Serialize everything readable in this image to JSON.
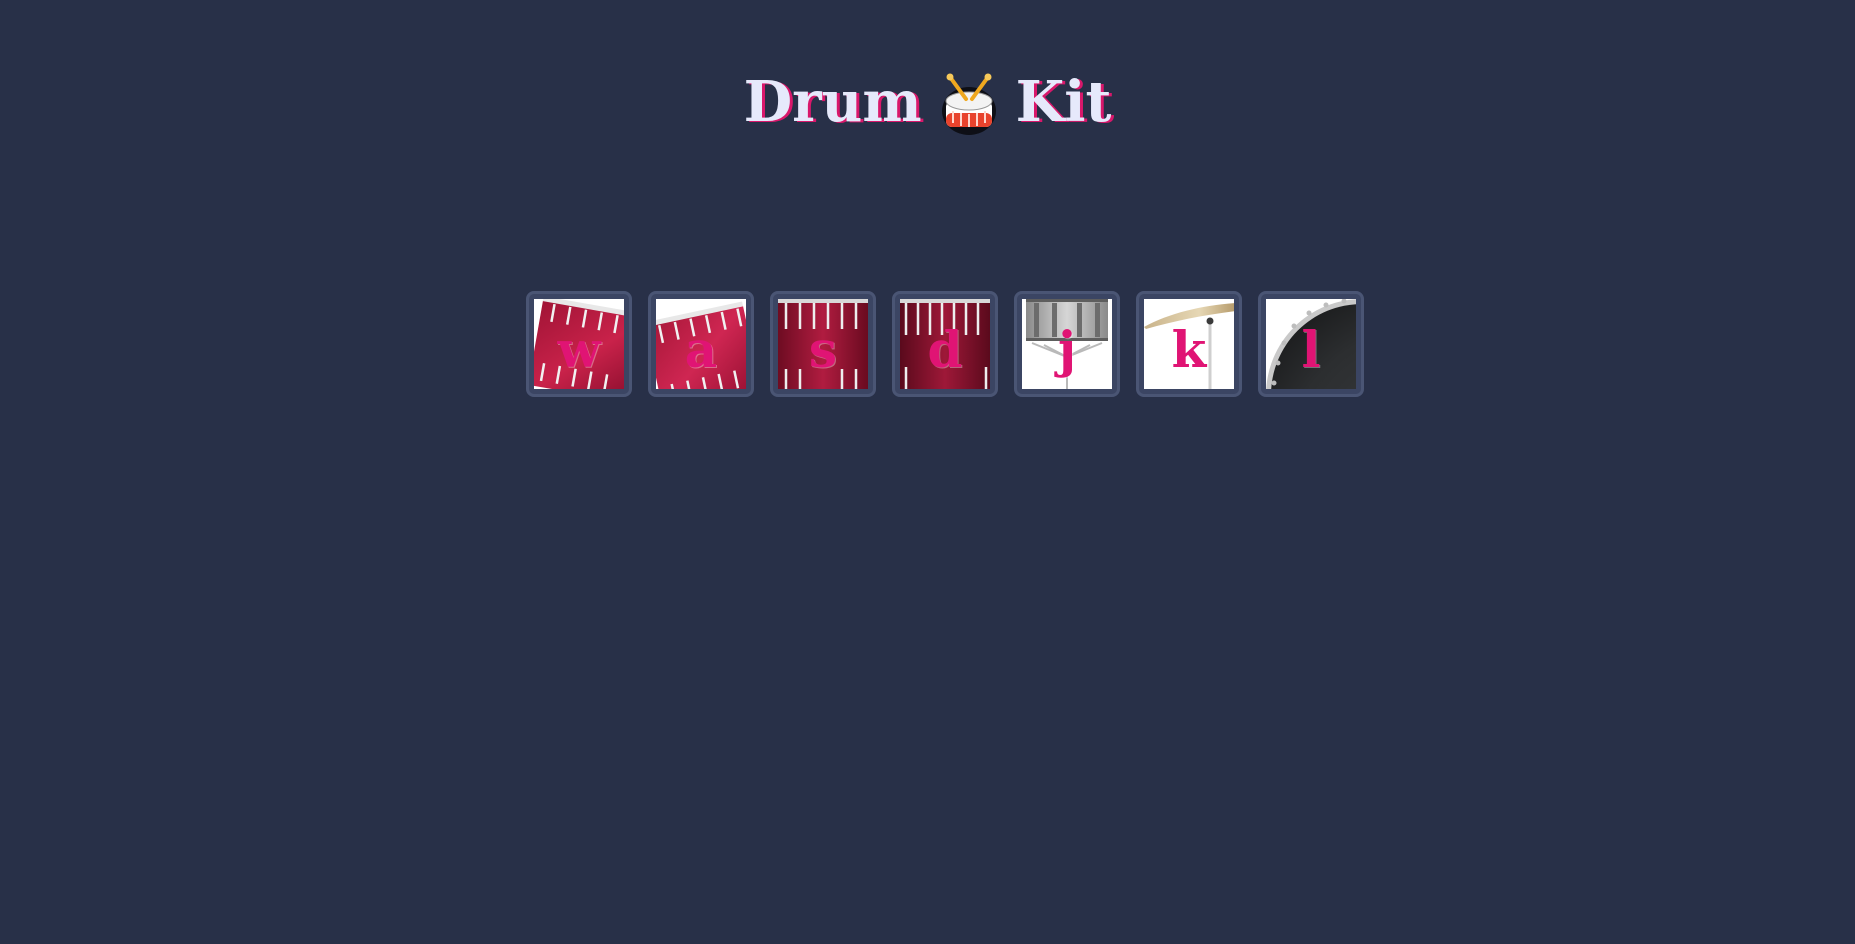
{
  "header": {
    "title_left": "Drum",
    "title_icon": "drum-emoji-icon",
    "title_right": "Kit"
  },
  "pads": [
    {
      "key": "w",
      "image": "tom-drum-1"
    },
    {
      "key": "a",
      "image": "tom-drum-2"
    },
    {
      "key": "s",
      "image": "tom-drum-3"
    },
    {
      "key": "d",
      "image": "tom-drum-4"
    },
    {
      "key": "j",
      "image": "snare-drum"
    },
    {
      "key": "k",
      "image": "crash-cymbal"
    },
    {
      "key": "l",
      "image": "kick-drum"
    }
  ],
  "colors": {
    "background": "#283048",
    "title_text": "#e6e9fb",
    "title_shadow": "#d9176b",
    "key_letter": "#e01474",
    "pad_border": "#4a5574",
    "drum_shell": "#b8183d"
  }
}
